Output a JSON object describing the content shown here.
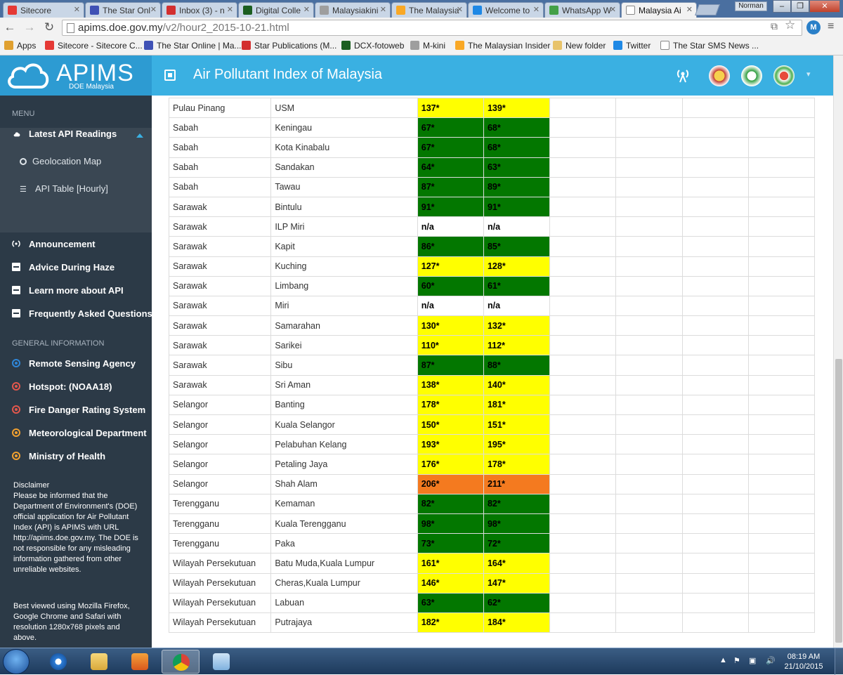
{
  "browser": {
    "tabs": [
      {
        "title": "Sitecore",
        "color": "#e53935"
      },
      {
        "title": "The Star Onl",
        "color": "#3f51b5"
      },
      {
        "title": "Inbox (3) - n",
        "color": "#d32f2f"
      },
      {
        "title": "Digital Colle",
        "color": "#1b5e20"
      },
      {
        "title": "Malaysiakini",
        "color": "#9e9e9e"
      },
      {
        "title": "The Malaysia",
        "color": "#f9a825"
      },
      {
        "title": "Welcome to",
        "color": "#1e88e5"
      },
      {
        "title": "WhatsApp W",
        "color": "#43a047"
      },
      {
        "title": "Malaysia Ai",
        "color": "#ffffff"
      }
    ],
    "profile_name": "Norman",
    "url_host": "apims.doe.gov.my",
    "url_path": "/v2/hour2_2015-10-21.html",
    "bookmarks": [
      {
        "label": "Apps",
        "color": "#e0a030"
      },
      {
        "label": "Sitecore - Sitecore C...",
        "color": "#e53935"
      },
      {
        "label": "The Star Online | Ma...",
        "color": "#3f51b5"
      },
      {
        "label": "Star Publications (M...",
        "color": "#d32f2f"
      },
      {
        "label": "DCX-fotoweb",
        "color": "#1b5e20"
      },
      {
        "label": "M-kini",
        "color": "#9e9e9e"
      },
      {
        "label": "The Malaysian Insider",
        "color": "#f9a825"
      },
      {
        "label": "New folder",
        "color": "#e8c36a"
      },
      {
        "label": "Twitter",
        "color": "#1e88e5"
      },
      {
        "label": "The Star SMS News ...",
        "color": "#ffffff"
      }
    ]
  },
  "header": {
    "logo": "APIMS",
    "logo_sub": "DOE Malaysia",
    "title": "Air Pollutant Index of Malaysia"
  },
  "sidebar": {
    "menu_heading": "MENU",
    "latest": "Latest API Readings",
    "sub_items": [
      "Geolocation Map",
      "API Table [Hourly]"
    ],
    "items": [
      "Announcement",
      "Advice During Haze",
      "Learn more about API",
      "Frequently Asked Questions"
    ],
    "general_heading": "GENERAL INFORMATION",
    "general_items": [
      {
        "label": "Remote Sensing Agency",
        "color": "#2f86d8"
      },
      {
        "label": "Hotspot: (NOAA18)",
        "color": "#e2574c"
      },
      {
        "label": "Fire Danger Rating System",
        "color": "#e2574c"
      },
      {
        "label": "Meteorological Department",
        "color": "#f0a030"
      },
      {
        "label": "Ministry of Health",
        "color": "#f0a030"
      }
    ],
    "disclaimer": "Disclaimer\nPlease be informed that the Department of Environment's (DOE) official application for Air Pollutant Index (API) is APIMS with URL http://apims.doe.gov.my. The DOE is not responsible for any misleading information gathered from other unreliable websites.",
    "best_viewed": "Best viewed using Mozilla Firefox, Google Chrome and Safari with resolution 1280x768 pixels and above."
  },
  "colors": {
    "good": "#037700",
    "moderate": "#ffff00",
    "unhealthy": "#f47a1f",
    "na": "#ffffff"
  },
  "table": {
    "rows": [
      {
        "state": "Pulau Pinang",
        "area": "USM",
        "v1": "137*",
        "v2": "139*",
        "c1": "moderate",
        "c2": "moderate"
      },
      {
        "state": "Sabah",
        "area": "Keningau",
        "v1": "67*",
        "v2": "68*",
        "c1": "good",
        "c2": "good"
      },
      {
        "state": "Sabah",
        "area": "Kota Kinabalu",
        "v1": "67*",
        "v2": "68*",
        "c1": "good",
        "c2": "good"
      },
      {
        "state": "Sabah",
        "area": "Sandakan",
        "v1": "64*",
        "v2": "63*",
        "c1": "good",
        "c2": "good"
      },
      {
        "state": "Sabah",
        "area": "Tawau",
        "v1": "87*",
        "v2": "89*",
        "c1": "good",
        "c2": "good"
      },
      {
        "state": "Sarawak",
        "area": "Bintulu",
        "v1": "91*",
        "v2": "91*",
        "c1": "good",
        "c2": "good"
      },
      {
        "state": "Sarawak",
        "area": "ILP Miri",
        "v1": "n/a",
        "v2": "n/a",
        "c1": "na",
        "c2": "na"
      },
      {
        "state": "Sarawak",
        "area": "Kapit",
        "v1": "86*",
        "v2": "85*",
        "c1": "good",
        "c2": "good"
      },
      {
        "state": "Sarawak",
        "area": "Kuching",
        "v1": "127*",
        "v2": "128*",
        "c1": "moderate",
        "c2": "moderate"
      },
      {
        "state": "Sarawak",
        "area": "Limbang",
        "v1": "60*",
        "v2": "61*",
        "c1": "good",
        "c2": "good"
      },
      {
        "state": "Sarawak",
        "area": "Miri",
        "v1": "n/a",
        "v2": "n/a",
        "c1": "na",
        "c2": "na"
      },
      {
        "state": "Sarawak",
        "area": "Samarahan",
        "v1": "130*",
        "v2": "132*",
        "c1": "moderate",
        "c2": "moderate"
      },
      {
        "state": "Sarawak",
        "area": "Sarikei",
        "v1": "110*",
        "v2": "112*",
        "c1": "moderate",
        "c2": "moderate"
      },
      {
        "state": "Sarawak",
        "area": "Sibu",
        "v1": "87*",
        "v2": "88*",
        "c1": "good",
        "c2": "good"
      },
      {
        "state": "Sarawak",
        "area": "Sri Aman",
        "v1": "138*",
        "v2": "140*",
        "c1": "moderate",
        "c2": "moderate"
      },
      {
        "state": "Selangor",
        "area": "Banting",
        "v1": "178*",
        "v2": "181*",
        "c1": "moderate",
        "c2": "moderate"
      },
      {
        "state": "Selangor",
        "area": "Kuala Selangor",
        "v1": "150*",
        "v2": "151*",
        "c1": "moderate",
        "c2": "moderate"
      },
      {
        "state": "Selangor",
        "area": "Pelabuhan Kelang",
        "v1": "193*",
        "v2": "195*",
        "c1": "moderate",
        "c2": "moderate"
      },
      {
        "state": "Selangor",
        "area": "Petaling Jaya",
        "v1": "176*",
        "v2": "178*",
        "c1": "moderate",
        "c2": "moderate"
      },
      {
        "state": "Selangor",
        "area": "Shah Alam",
        "v1": "206*",
        "v2": "211*",
        "c1": "unhealthy",
        "c2": "unhealthy"
      },
      {
        "state": "Terengganu",
        "area": "Kemaman",
        "v1": "82*",
        "v2": "82*",
        "c1": "good",
        "c2": "good"
      },
      {
        "state": "Terengganu",
        "area": "Kuala Terengganu",
        "v1": "98*",
        "v2": "98*",
        "c1": "good",
        "c2": "good"
      },
      {
        "state": "Terengganu",
        "area": "Paka",
        "v1": "73*",
        "v2": "72*",
        "c1": "good",
        "c2": "good"
      },
      {
        "state": "Wilayah Persekutuan",
        "area": "Batu Muda,Kuala Lumpur",
        "v1": "161*",
        "v2": "164*",
        "c1": "moderate",
        "c2": "moderate"
      },
      {
        "state": "Wilayah Persekutuan",
        "area": "Cheras,Kuala Lumpur",
        "v1": "146*",
        "v2": "147*",
        "c1": "moderate",
        "c2": "moderate"
      },
      {
        "state": "Wilayah Persekutuan",
        "area": "Labuan",
        "v1": "63*",
        "v2": "62*",
        "c1": "good",
        "c2": "good"
      },
      {
        "state": "Wilayah Persekutuan",
        "area": "Putrajaya",
        "v1": "182*",
        "v2": "184*",
        "c1": "moderate",
        "c2": "moderate"
      }
    ]
  },
  "taskbar": {
    "time": "08:19 AM",
    "date": "21/10/2015"
  }
}
